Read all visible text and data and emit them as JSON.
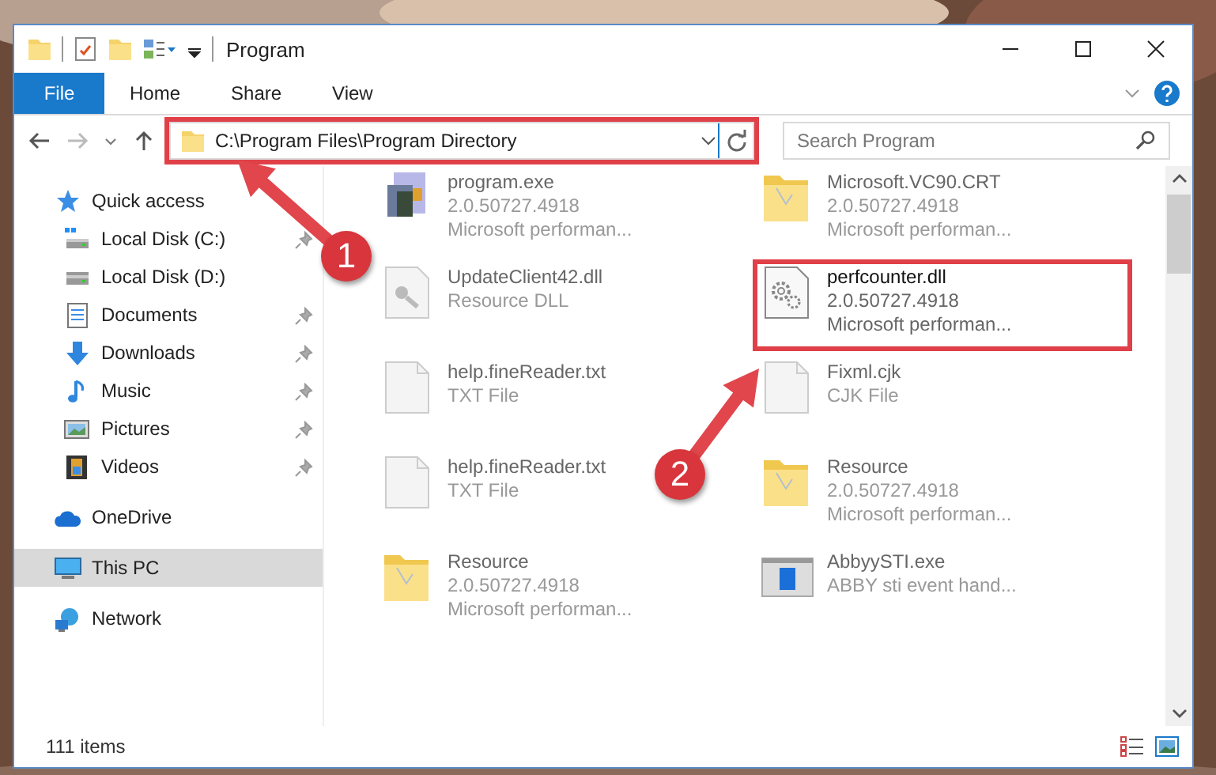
{
  "window": {
    "title": "Program"
  },
  "ribbon_tabs": [
    {
      "label": "File",
      "selected": true
    },
    {
      "label": "Home",
      "selected": false
    },
    {
      "label": "Share",
      "selected": false
    },
    {
      "label": "View",
      "selected": false
    }
  ],
  "address": {
    "path": "C:\\Program Files\\Program Directory",
    "highlighted": true
  },
  "search": {
    "placeholder": "Search Program"
  },
  "sidebar": {
    "items": [
      {
        "label": "Quick access",
        "kind": "star",
        "selected": false,
        "children": [
          {
            "label": "Local Disk (C:)",
            "kind": "drive-c",
            "pinned": true,
            "selected": false
          },
          {
            "label": "Local Disk (D:)",
            "kind": "drive",
            "pinned": false,
            "selected": false
          },
          {
            "label": "Documents",
            "kind": "documents",
            "pinned": true,
            "selected": false
          },
          {
            "label": "Downloads",
            "kind": "downloads",
            "pinned": true,
            "selected": false
          },
          {
            "label": "Music",
            "kind": "music",
            "pinned": true,
            "selected": false
          },
          {
            "label": "Pictures",
            "kind": "pictures",
            "pinned": true,
            "selected": false
          },
          {
            "label": "Videos",
            "kind": "videos",
            "pinned": true,
            "selected": false
          }
        ]
      },
      {
        "label": "OneDrive",
        "kind": "cloud",
        "selected": false
      },
      {
        "label": "This PC",
        "kind": "pc",
        "selected": true
      },
      {
        "label": "Network",
        "kind": "network",
        "selected": false
      }
    ]
  },
  "files": [
    {
      "name": "program.exe",
      "kind": "exe",
      "lines": [
        "2.0.50727.4918",
        "Microsoft performan..."
      ],
      "highlighted": false
    },
    {
      "name": "Microsoft.VC90.CRT",
      "kind": "folder",
      "lines": [
        "2.0.50727.4918",
        "Microsoft performan..."
      ],
      "highlighted": false
    },
    {
      "name": "UpdateClient42.dll",
      "kind": "dll",
      "lines": [
        "Resource DLL"
      ],
      "highlighted": false
    },
    {
      "name": "perfcounter.dll",
      "kind": "gear",
      "lines": [
        "2.0.50727.4918",
        "Microsoft performan..."
      ],
      "highlighted": true
    },
    {
      "name": "help.fineReader.txt",
      "kind": "txt",
      "lines": [
        "TXT File"
      ],
      "highlighted": false
    },
    {
      "name": "Fixml.cjk",
      "kind": "txt",
      "lines": [
        "CJK File"
      ],
      "highlighted": false
    },
    {
      "name": "help.fineReader.txt",
      "kind": "txt",
      "lines": [
        "TXT File"
      ],
      "highlighted": false
    },
    {
      "name": "Resource",
      "kind": "folder",
      "lines": [
        "2.0.50727.4918",
        "Microsoft performan..."
      ],
      "highlighted": false
    },
    {
      "name": "Resource",
      "kind": "folder",
      "lines": [
        "2.0.50727.4918",
        "Microsoft performan..."
      ],
      "highlighted": false
    },
    {
      "name": "AbbyySTI.exe",
      "kind": "app",
      "lines": [
        "ABBY sti event hand..."
      ],
      "highlighted": false
    }
  ],
  "status_bar": {
    "item_count": "111 items"
  },
  "annotations": [
    {
      "number": "1"
    },
    {
      "number": "2"
    }
  ]
}
